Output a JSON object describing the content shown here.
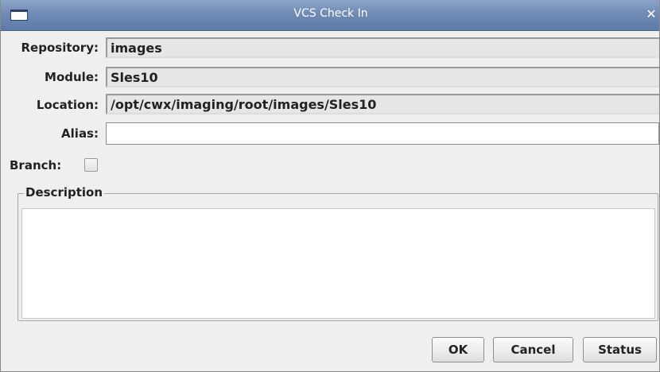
{
  "window": {
    "title": "VCS Check In",
    "close_glyph": "✕",
    "icon": "window-menu-icon"
  },
  "form": {
    "repository_label": "Repository:",
    "repository_value": "images",
    "module_label": "Module:",
    "module_value": "Sles10",
    "location_label": "Location:",
    "location_value": "/opt/cwx/imaging/root/images/Sles10",
    "alias_label": "Alias:",
    "alias_value": "",
    "branch_label": "Branch:",
    "branch_checked": false
  },
  "description": {
    "legend": "Description",
    "value": ""
  },
  "buttons": {
    "ok": "OK",
    "cancel": "Cancel",
    "status": "Status"
  },
  "colors": {
    "titlebar": "#6f8bb6",
    "dialog_bg": "#efefef",
    "readonly_field_bg": "#e6e6e6"
  }
}
